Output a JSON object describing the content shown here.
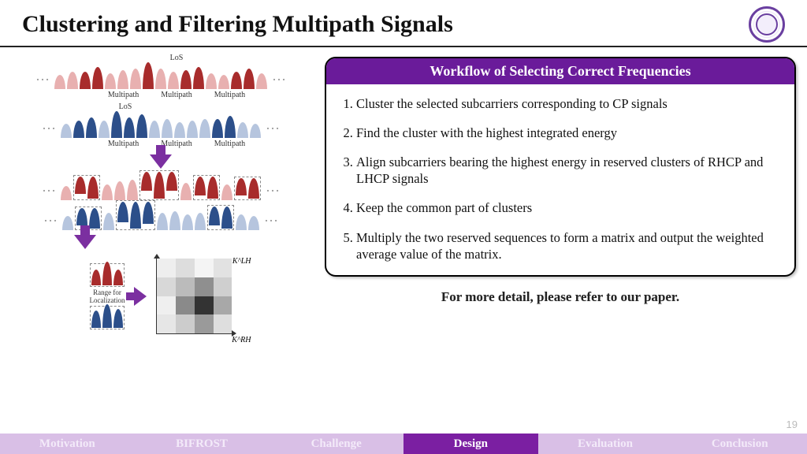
{
  "header": {
    "title": "Clustering and Filtering Multipath Signals"
  },
  "diagram": {
    "ellipsis": "…",
    "los": "LoS",
    "multipath": "Multipath",
    "range_label": "Range for\nLocalization",
    "axis_y": "K^LH",
    "axis_x": "K^RH"
  },
  "panel": {
    "heading": "Workflow of Selecting Correct Frequencies",
    "steps": [
      "Cluster the selected subcarriers corresponding to CP signals",
      "Find the cluster with the highest integrated energy",
      "Align subcarriers bearing the highest energy in reserved clusters of RHCP and LHCP signals",
      "Keep the common part of clusters",
      "Multiply the two reserved sequences to form a matrix and output the weighted average value of the matrix."
    ]
  },
  "footnote": "For more detail, please refer to our paper.",
  "page_number": "19",
  "nav": {
    "items": [
      "Motivation",
      "BIFROST",
      "Challenge",
      "Design",
      "Evaluation",
      "Conclusion"
    ],
    "active_index": 3
  },
  "matrix_shades": [
    "#eee",
    "#ddd",
    "#f4f4f4",
    "#e2e2e2",
    "#d8d8d8",
    "#bbb",
    "#8f8f8f",
    "#cfcfcf",
    "#efefef",
    "#8a8a8a",
    "#333",
    "#a8a8a8",
    "#e6e6e6",
    "#cccccc",
    "#9a9a9a",
    "#dedede"
  ]
}
